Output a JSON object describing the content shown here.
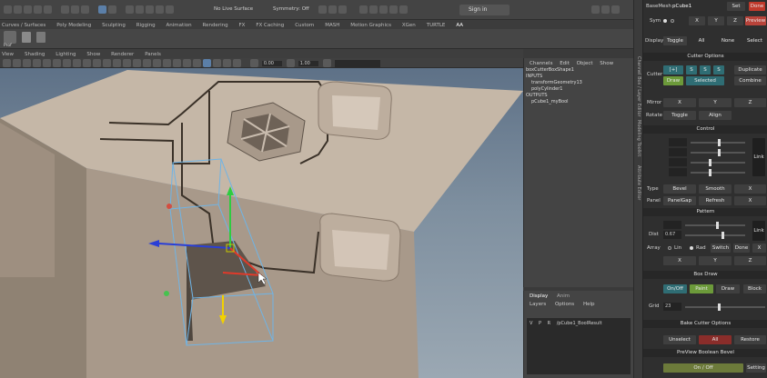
{
  "status_bar": {
    "live_surface": "No Live Surface",
    "symmetry": "Symmetry: Off",
    "sign_in": "Sign in"
  },
  "shelf_tabs": [
    "Curves / Surfaces",
    "Poly Modeling",
    "Sculpting",
    "Rigging",
    "Animation",
    "Rendering",
    "FX",
    "FX Caching",
    "Custom",
    "MASH",
    "Motion Graphics",
    "XGen",
    "TURTLE",
    "AA"
  ],
  "shelf_item": "Prof",
  "panel_menu": [
    "View",
    "Shading",
    "Lighting",
    "Show",
    "Renderer",
    "Panels"
  ],
  "panel_toolbar": {
    "field1": "0.00",
    "field2": "1.00"
  },
  "channel_box": {
    "tabs": [
      "Channels",
      "Edit",
      "Object",
      "Show"
    ],
    "shape": "boxCutterBoxShape1",
    "inputs_label": "INPUTS",
    "inputs": [
      "transformGeometry13",
      "polyCylinder1"
    ],
    "outputs_label": "OUTPUTS",
    "outputs": [
      "pCube1_myBool"
    ]
  },
  "layer_panel": {
    "tabs": [
      "Display",
      "Anim"
    ],
    "menu": [
      "Layers",
      "Options",
      "Help"
    ],
    "row": {
      "v": "V",
      "p": "P",
      "r": "R",
      "name": "/pCube1_BoolResult"
    }
  },
  "side_strip_labels": [
    "Channel Box / Layer Editor",
    "Modeling Toolkit",
    "Attribute Editor"
  ],
  "tool_panel": {
    "basemesh_label": "BaseMesh",
    "basemesh_value": "pCube1",
    "set": "Set",
    "done": "Done",
    "sym_label": "Sym",
    "sym_x": "X",
    "sym_y": "Y",
    "sym_z": "Z",
    "preview": "Preview",
    "display_label": "Display",
    "toggle": "Toggle",
    "all": "All",
    "none": "None",
    "select": "Select",
    "cutter_options": "Cutter Options",
    "cutter_label": "Cutter",
    "cutter_ops": [
      "[+]",
      "S",
      "S",
      "S"
    ],
    "duplicate": "Duplicate",
    "draw": "Draw",
    "selected": "Selected",
    "combine": "Combine",
    "mirror_label": "Mirror",
    "mirror_x": "X",
    "mirror_y": "Y",
    "mirror_z": "Z",
    "rotate_label": "Rotate",
    "rotate_toggle": "Toggle",
    "align": "Align",
    "control": "Control",
    "link": "Link",
    "type_label": "Type",
    "bevel": "Bevel",
    "smooth": "Smooth",
    "type_x": "X",
    "panel_label": "Panel",
    "panel_gap": "PanelGap",
    "refresh": "Refresh",
    "panel_x": "X",
    "pattern": "Pattern",
    "dist_label": "Dist",
    "dist_value": "0.67",
    "link2": "Link",
    "array_label": "Array",
    "lin": "Lin",
    "rad": "Rad",
    "switch": "Switch",
    "done2": "Done",
    "array_x": "X",
    "axis_x": "X",
    "axis_y": "Y",
    "axis_z": "Z",
    "box_draw": "Box Draw",
    "on_off": "On/Off",
    "paint": "Paint",
    "draw2": "Draw",
    "block": "Block",
    "grid_label": "Grid",
    "grid_value": "23",
    "bake_options": "Bake Cutter Options",
    "unselect": "Unselect",
    "bake_all": "All",
    "restore": "Restore",
    "preview_bevel": "PreView Boolean Bevel",
    "bevel_onoff": "On / Off",
    "setting": "Setting"
  }
}
